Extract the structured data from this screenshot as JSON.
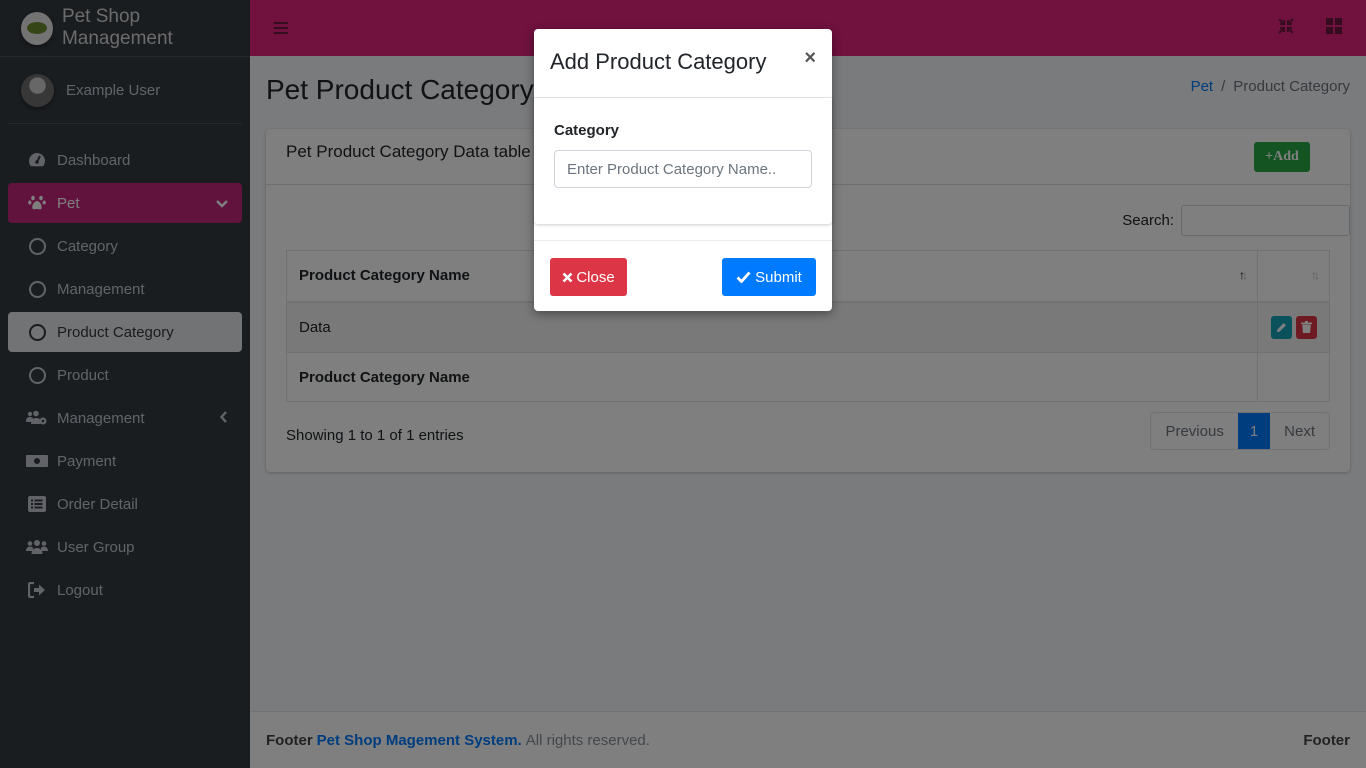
{
  "app": {
    "brand": "Pet Shop Management",
    "user": "Example User"
  },
  "sidebar": {
    "items": [
      {
        "label": "Dashboard",
        "icon": "tachometer-icon"
      },
      {
        "label": "Pet",
        "icon": "paw-icon",
        "state": "open"
      },
      {
        "label": "Category",
        "icon": "circle-icon"
      },
      {
        "label": "Management",
        "icon": "circle-icon"
      },
      {
        "label": "Product Category",
        "icon": "circle-icon",
        "state": "active"
      },
      {
        "label": "Product",
        "icon": "circle-icon"
      },
      {
        "label": "Management",
        "icon": "users-cog-icon"
      },
      {
        "label": "Payment",
        "icon": "money-bill-icon"
      },
      {
        "label": "Order Detail",
        "icon": "list-alt-icon"
      },
      {
        "label": "User Group",
        "icon": "users-icon"
      },
      {
        "label": "Logout",
        "icon": "sign-out-icon"
      }
    ]
  },
  "navbar": {
    "menu_icon": "bars-icon",
    "fullscreen_icon": "compress-icon",
    "grid_icon": "th-large-icon",
    "accent": "#e0237c"
  },
  "page": {
    "title": "Pet Product Category",
    "breadcrumb": [
      {
        "label": "Pet",
        "link": true
      },
      {
        "label": "Product Category",
        "link": false
      }
    ]
  },
  "card": {
    "title": "Pet Product Category Data table",
    "add_label": "+Add",
    "search_label": "Search:",
    "search_value": "",
    "table": {
      "columns": [
        "Product Category Name",
        ""
      ],
      "rows": [
        {
          "name": "Data"
        }
      ],
      "footer": [
        "Product Category Name",
        ""
      ]
    },
    "info": "Showing 1 to 1 of 1 entries",
    "pagination": {
      "previous": "Previous",
      "pages": [
        "1"
      ],
      "current": "1",
      "next": "Next"
    }
  },
  "footer": {
    "prefix": "Footer",
    "link": "Pet Shop Magement System.",
    "suffix": "All rights reserved.",
    "right": "Footer"
  },
  "modal": {
    "title": "Add Product Category",
    "close_symbol": "×",
    "field_label": "Category",
    "field_placeholder": "Enter Product Category Name..",
    "field_value": "",
    "close_label": "Close",
    "submit_label": "Submit"
  }
}
